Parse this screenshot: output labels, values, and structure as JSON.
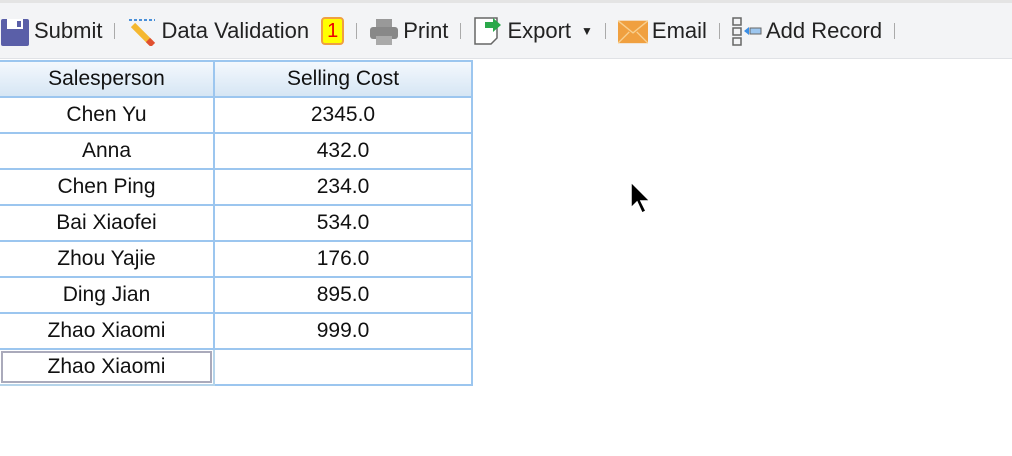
{
  "toolbar": {
    "submit": "Submit",
    "data_validation": "Data Validation",
    "validation_badge": "1",
    "print": "Print",
    "export": "Export",
    "email": "Email",
    "add_record": "Add Record"
  },
  "table": {
    "headers": [
      "Salesperson",
      "Selling Cost"
    ],
    "rows": [
      [
        "Chen Yu",
        "2345.0"
      ],
      [
        "Anna",
        "432.0"
      ],
      [
        "Chen Ping",
        "234.0"
      ],
      [
        "Bai Xiaofei",
        "534.0"
      ],
      [
        "Zhou Yajie",
        "176.0"
      ],
      [
        "Ding Jian",
        "895.0"
      ],
      [
        "Zhao Xiaomi",
        "999.0"
      ],
      [
        "Zhao Xiaomi",
        ""
      ]
    ]
  }
}
